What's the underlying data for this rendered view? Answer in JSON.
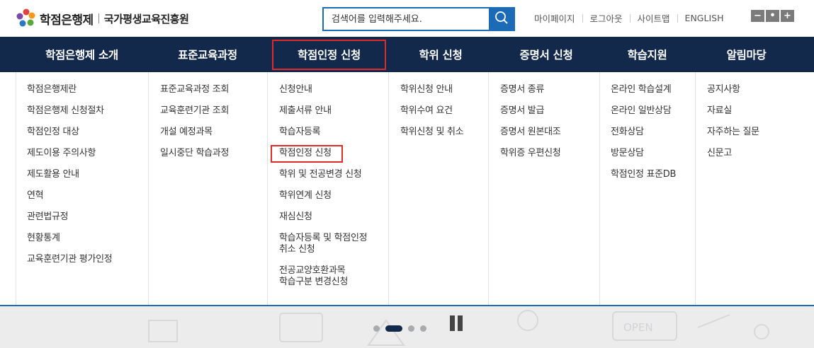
{
  "header": {
    "logo_title": "학점은행제",
    "logo_org": "국가평생교육진흥원",
    "search_placeholder": "검색어를 입력해주세요.",
    "util_links": [
      "마이페이지",
      "로그아웃",
      "사이트맵",
      "ENGLISH"
    ],
    "zoom": {
      "out": "−",
      "reset": "•",
      "in": "+"
    }
  },
  "gnb": [
    "학점은행제 소개",
    "표준교육과정",
    "학점인정 신청",
    "학위 신청",
    "증명서 신청",
    "학습지원",
    "알림마당"
  ],
  "submenu": [
    [
      "학점은행제란",
      "학점은행제 신청절차",
      "학점인정 대상",
      "제도이용 주의사항",
      "제도활용 안내",
      "연혁",
      "관련법규정",
      "현황통계",
      "교육훈련기관 평가인정"
    ],
    [
      "표준교육과정 조회",
      "교육훈련기관 조회",
      "개설 예정과목",
      "일시중단 학습과정"
    ],
    [
      "신청안내",
      "제출서류 안내",
      "학습자등록",
      "학점인정 신청",
      "학위 및 전공변경 신청",
      "학위연계 신청",
      "재심신청",
      "학습자등록 및 학점인정\n취소 신청",
      "전공교양호환과목\n학습구분 변경신청"
    ],
    [
      "학위신청 안내",
      "학위수여 요건",
      "학위신청 및 취소"
    ],
    [
      "증명서 종류",
      "증명서 발급",
      "증명서 원본대조",
      "학위증 우편신청"
    ],
    [
      "온라인 학습설계",
      "온라인 일반상담",
      "전화상담",
      "방문상담",
      "학점인정 표준DB"
    ],
    [
      "공지사항",
      "자료실",
      "자주하는 질문",
      "신문고"
    ]
  ],
  "colors": {
    "navy": "#13294b",
    "blue": "#1d6ab7",
    "highlight": "#e02a2a"
  },
  "banner": {
    "open_sign": "OPEN"
  }
}
